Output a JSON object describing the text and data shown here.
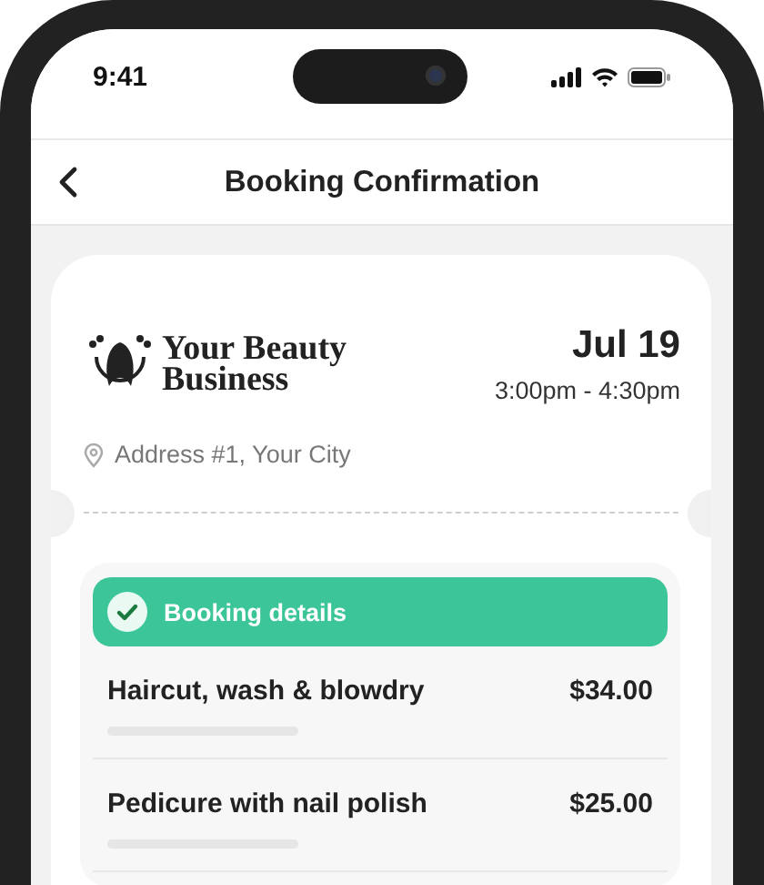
{
  "status_bar": {
    "time": "9:41"
  },
  "header": {
    "title": "Booking Confirmation"
  },
  "business": {
    "name": "Your Beauty Business",
    "date": "Jul 19",
    "time_range": "3:00pm - 4:30pm",
    "address": "Address #1, Your City"
  },
  "details": {
    "title": "Booking details",
    "checked": true,
    "services": [
      {
        "name": "Haircut, wash & blowdry",
        "price": "$34.00"
      },
      {
        "name": "Pedicure with nail polish",
        "price": "$25.00"
      }
    ]
  }
}
